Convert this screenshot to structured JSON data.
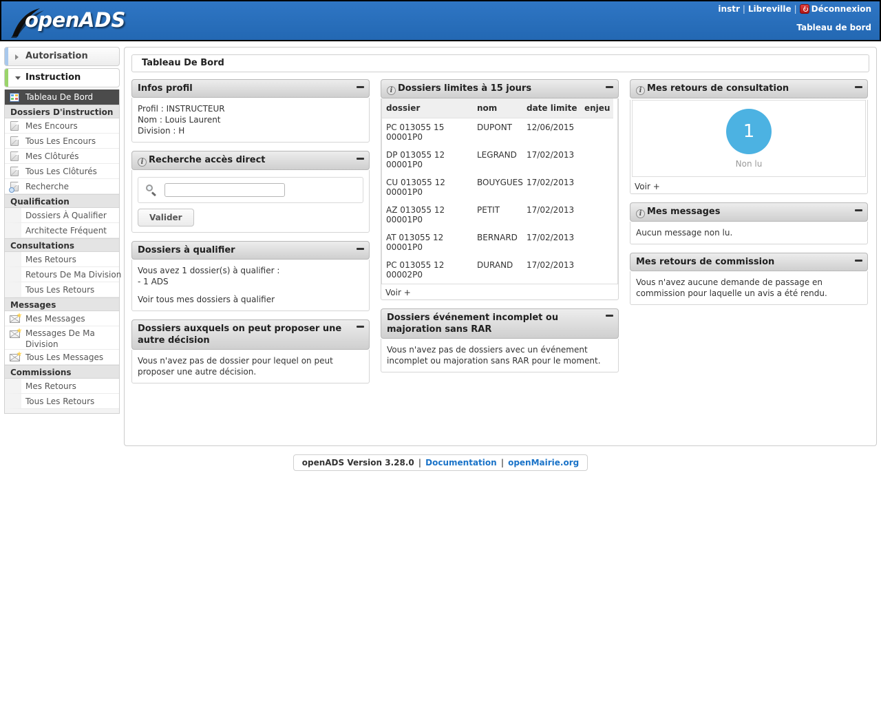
{
  "header": {
    "logo_text_open": "open",
    "logo_text_ads": "ADS",
    "user": "instr",
    "city": "Libreville",
    "logout": "Déconnexion",
    "subtitle": "Tableau de bord",
    "bg_color": "#2a6ebb"
  },
  "sidebar": {
    "top_items": [
      {
        "label": "Autorisation",
        "state": "collapsed",
        "tab_color": "#a8c8ec"
      },
      {
        "label": "Instruction",
        "state": "expanded",
        "tab_color": "#9ad46a"
      }
    ],
    "active_item": "Tableau De Bord",
    "groups": [
      {
        "title": "Dossiers D'instruction",
        "items": [
          {
            "label": "Mes Encours",
            "icon": "page-icon"
          },
          {
            "label": "Tous Les Encours",
            "icon": "page-icon"
          },
          {
            "label": "Mes Clôturés",
            "icon": "page-icon"
          },
          {
            "label": "Tous Les Clôturés",
            "icon": "page-icon"
          },
          {
            "label": "Recherche",
            "icon": "page-search-icon"
          }
        ]
      },
      {
        "title": "Qualification",
        "items": [
          {
            "label": "Dossiers À Qualifier",
            "icon": "none"
          },
          {
            "label": "Architecte Fréquent",
            "icon": "none"
          }
        ]
      },
      {
        "title": "Consultations",
        "items": [
          {
            "label": "Mes Retours",
            "icon": "none"
          },
          {
            "label": "Retours De Ma Division",
            "icon": "none"
          },
          {
            "label": "Tous Les Retours",
            "icon": "none"
          }
        ]
      },
      {
        "title": "Messages",
        "items": [
          {
            "label": "Mes Messages",
            "icon": "mail-icon"
          },
          {
            "label": "Messages De Ma Division",
            "icon": "mail-icon"
          },
          {
            "label": "Tous Les Messages",
            "icon": "mail-icon"
          }
        ]
      },
      {
        "title": "Commissions",
        "items": [
          {
            "label": "Mes Retours",
            "icon": "none"
          },
          {
            "label": "Tous Les Retours",
            "icon": "none"
          }
        ]
      }
    ]
  },
  "main": {
    "page_title": "Tableau De Bord",
    "widgets": {
      "infos_profil": {
        "title": "Infos profil",
        "has_info_icon": false,
        "lines": [
          "Profil : INSTRUCTEUR",
          "Nom : Louis Laurent",
          "Division : H"
        ]
      },
      "recherche": {
        "title": "Recherche accès direct",
        "has_info_icon": true,
        "input_value": "",
        "input_placeholder": "",
        "button_label": "Valider"
      },
      "a_qualifier": {
        "title": "Dossiers à qualifier",
        "has_info_icon": false,
        "line1": "Vous avez 1 dossier(s) à qualifier :",
        "line2": "- 1 ADS",
        "link": "Voir tous mes dossiers à qualifier"
      },
      "autre_decision": {
        "title": "Dossiers auxquels on peut proposer une autre décision",
        "has_info_icon": false,
        "body": "Vous n'avez pas de dossier pour lequel on peut proposer une autre décision."
      },
      "limites": {
        "title": "Dossiers limites à 15 jours",
        "has_info_icon": true,
        "columns": [
          "dossier",
          "nom",
          "date limite",
          "enjeu"
        ],
        "rows": [
          {
            "dossier": "PC 013055 15 00001P0",
            "nom": "DUPONT",
            "date": "12/06/2015",
            "enjeu": ""
          },
          {
            "dossier": "DP 013055 12 00001P0",
            "nom": "LEGRAND",
            "date": "17/02/2013",
            "enjeu": ""
          },
          {
            "dossier": "CU 013055 12 00001P0",
            "nom": "BOUYGUES",
            "date": "17/02/2013",
            "enjeu": ""
          },
          {
            "dossier": "AZ 013055 12 00001P0",
            "nom": "PETIT",
            "date": "17/02/2013",
            "enjeu": ""
          },
          {
            "dossier": "AT 013055 12 00001P0",
            "nom": "BERNARD",
            "date": "17/02/2013",
            "enjeu": ""
          },
          {
            "dossier": "PC 013055 12 00002P0",
            "nom": "DURAND",
            "date": "17/02/2013",
            "enjeu": ""
          }
        ],
        "more_link": "Voir +"
      },
      "evenement_incomplet": {
        "title": "Dossiers événement incomplet ou majoration sans RAR",
        "has_info_icon": false,
        "body": "Vous n'avez pas de dossiers avec un événement incomplet ou majoration sans RAR pour le moment."
      },
      "retours_consultation": {
        "title": "Mes retours de consultation",
        "has_info_icon": true,
        "count": "1",
        "count_label": "Non lu",
        "count_color": "#4cb2e2",
        "more_link": "Voir +"
      },
      "mes_messages": {
        "title": "Mes messages",
        "has_info_icon": true,
        "body": "Aucun message non lu."
      },
      "retours_commission": {
        "title": "Mes retours de commission",
        "has_info_icon": false,
        "body": "Vous n'avez aucune demande de passage en commission pour laquelle un avis a été rendu."
      }
    }
  },
  "footer": {
    "version": "openADS Version 3.28.0",
    "doc_link": "Documentation",
    "site_link": "openMairie.org",
    "separator": "|"
  }
}
